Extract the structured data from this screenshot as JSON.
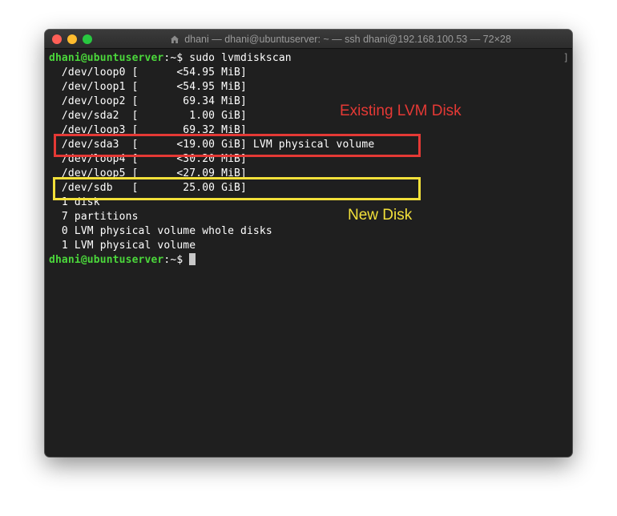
{
  "window": {
    "title": "dhani — dhani@ubuntuserver: ~ — ssh dhani@192.168.100.53 — 72×28",
    "scroll_marker": "]"
  },
  "terminal": {
    "prompt_user": "dhani@ubuntuserver",
    "prompt_path": ":~",
    "prompt_symbol": "$ ",
    "command": "sudo lvmdiskscan",
    "output": [
      "  /dev/loop0 [      <54.95 MiB]",
      "  /dev/loop1 [      <54.95 MiB]",
      "  /dev/loop2 [       69.34 MiB]",
      "  /dev/sda2  [        1.00 GiB]",
      "  /dev/loop3 [       69.32 MiB]",
      "  /dev/sda3  [      <19.00 GiB] LVM physical volume",
      "  /dev/loop4 [      <30.20 MiB]",
      "  /dev/loop5 [      <27.09 MiB]",
      "  /dev/sdb   [       25.00 GiB]",
      "  1 disk",
      "  7 partitions",
      "  0 LVM physical volume whole disks",
      "  1 LVM physical volume"
    ]
  },
  "annotations": {
    "existing": "Existing LVM Disk",
    "new": "New Disk",
    "existing_color": "#e53935",
    "new_color": "#f2e03a"
  },
  "icons": {
    "close": "close-traffic-light",
    "minimize": "minimize-traffic-light",
    "maximize": "maximize-traffic-light",
    "title": "home-icon"
  }
}
